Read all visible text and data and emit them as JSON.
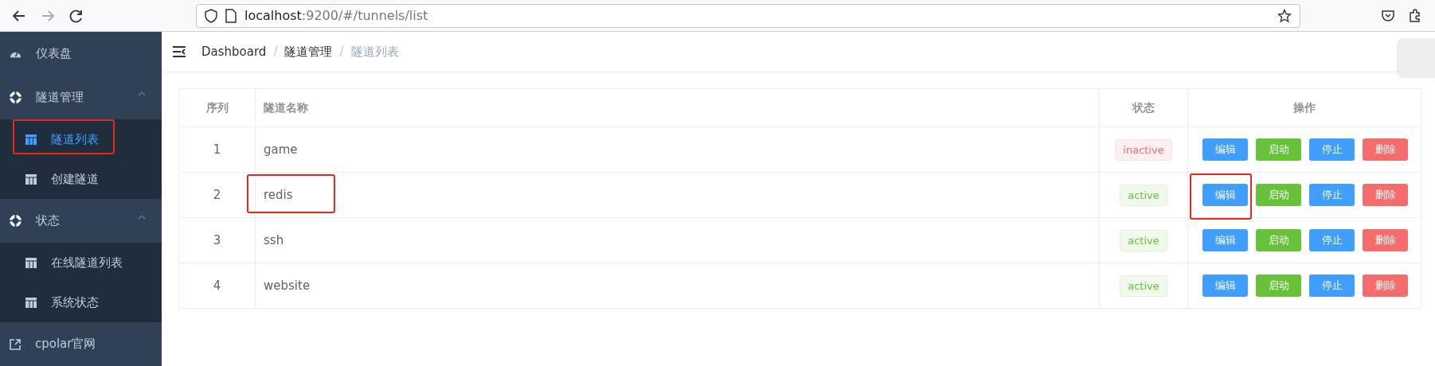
{
  "browser": {
    "back_disabled": false,
    "forward_disabled": true,
    "url_host": "localhost",
    "url_path": ":9200/#/tunnels/list"
  },
  "sidebar": {
    "items": [
      {
        "kind": "home",
        "label": "仪表盘"
      },
      {
        "kind": "group",
        "label": "隧道管理",
        "expanded": true,
        "children": [
          {
            "label": "隧道列表",
            "selected": true,
            "highlighted": true
          },
          {
            "label": "创建隧道",
            "selected": false,
            "highlighted": false
          }
        ]
      },
      {
        "kind": "group",
        "label": "状态",
        "expanded": true,
        "children": [
          {
            "label": "在线隧道列表",
            "selected": false,
            "highlighted": false
          },
          {
            "label": "系统状态",
            "selected": false,
            "highlighted": false
          }
        ]
      },
      {
        "kind": "external",
        "label": "cpolar官网"
      }
    ]
  },
  "breadcrumb": [
    {
      "kind": "link",
      "text": "Dashboard"
    },
    {
      "kind": "separator",
      "text": "/"
    },
    {
      "kind": "link",
      "text": "隧道管理"
    },
    {
      "kind": "separator",
      "text": "/"
    },
    {
      "kind": "current",
      "text": "隧道列表"
    }
  ],
  "table": {
    "columns": [
      "序列",
      "隧道名称",
      "状态",
      "操作"
    ],
    "rows": [
      {
        "index": "1",
        "name": "game",
        "name_highlighted": false,
        "status": {
          "text": "inactive",
          "kind": "danger"
        },
        "actions": [
          {
            "label": "编辑",
            "kind": "primary",
            "highlighted": false
          },
          {
            "label": "启动",
            "kind": "success",
            "highlighted": false
          },
          {
            "label": "停止",
            "kind": "primary",
            "highlighted": false
          },
          {
            "label": "删除",
            "kind": "danger",
            "highlighted": false
          }
        ]
      },
      {
        "index": "2",
        "name": "redis",
        "name_highlighted": true,
        "status": {
          "text": "active",
          "kind": "success"
        },
        "actions": [
          {
            "label": "编辑",
            "kind": "primary",
            "highlighted": true
          },
          {
            "label": "启动",
            "kind": "success",
            "highlighted": false
          },
          {
            "label": "停止",
            "kind": "primary",
            "highlighted": false
          },
          {
            "label": "删除",
            "kind": "danger",
            "highlighted": false
          }
        ]
      },
      {
        "index": "3",
        "name": "ssh",
        "name_highlighted": false,
        "status": {
          "text": "active",
          "kind": "success"
        },
        "actions": [
          {
            "label": "编辑",
            "kind": "primary",
            "highlighted": false
          },
          {
            "label": "启动",
            "kind": "success",
            "highlighted": false
          },
          {
            "label": "停止",
            "kind": "primary",
            "highlighted": false
          },
          {
            "label": "删除",
            "kind": "danger",
            "highlighted": false
          }
        ]
      },
      {
        "index": "4",
        "name": "website",
        "name_highlighted": false,
        "status": {
          "text": "active",
          "kind": "success"
        },
        "actions": [
          {
            "label": "编辑",
            "kind": "primary",
            "highlighted": false
          },
          {
            "label": "启动",
            "kind": "success",
            "highlighted": false
          },
          {
            "label": "停止",
            "kind": "primary",
            "highlighted": false
          },
          {
            "label": "删除",
            "kind": "danger",
            "highlighted": false
          }
        ]
      }
    ]
  }
}
